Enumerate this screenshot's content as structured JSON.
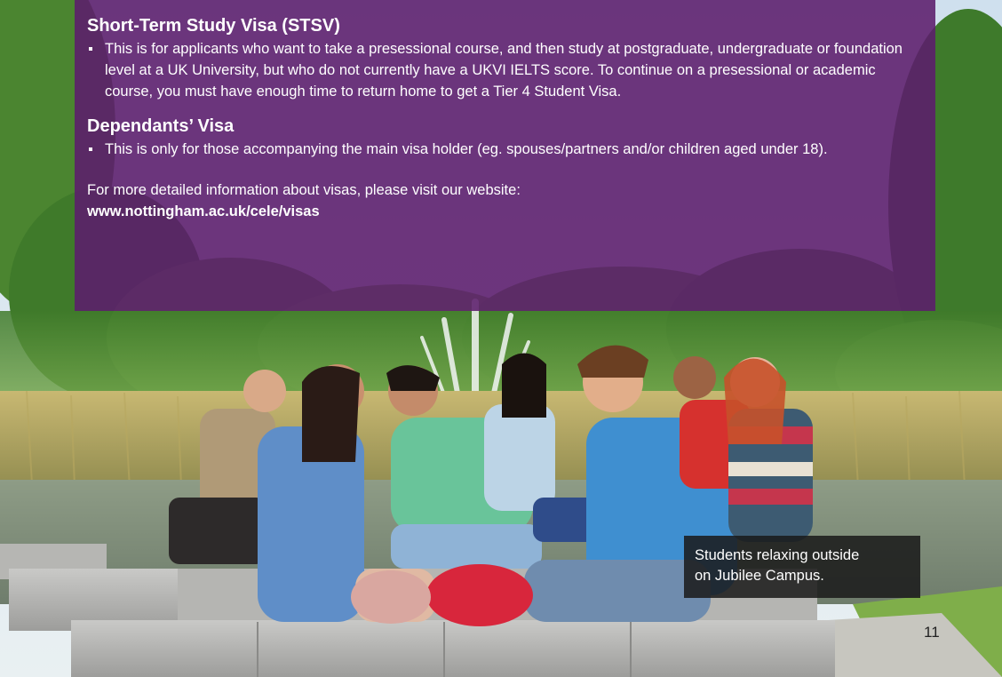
{
  "stsv": {
    "heading": "Short-Term Study Visa (STSV)",
    "bullet": "This is for applicants who want to take a presessional course, and then study at postgraduate, undergraduate or foundation level at a UK University, but who do not currently have a UKVI IELTS score. To continue on a presessional or academic course, you must have enough time to return home to get a Tier 4 Student Visa."
  },
  "dependants": {
    "heading": "Dependants’ Visa",
    "bullet": "This is only for those accompanying the main visa holder (eg. spouses/partners and/or children aged under 18)."
  },
  "more_info": {
    "text": "For more detailed information about visas, please visit our website:",
    "link": "www.nottingham.ac.uk/cele/visas"
  },
  "photo_caption": {
    "line1": "Students relaxing outside",
    "line2": "on Jubilee Campus."
  },
  "page_number": "11",
  "colors": {
    "panel_purple": "#5c1c6c",
    "caption_bg": "#1a1a1a"
  }
}
